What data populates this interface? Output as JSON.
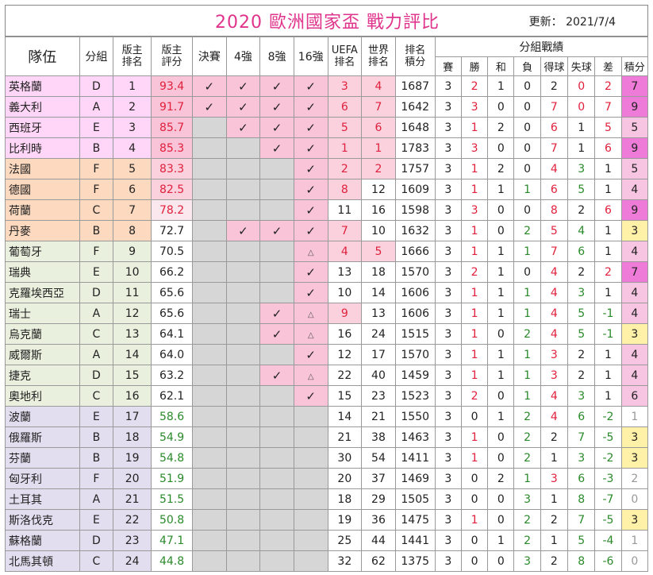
{
  "title": "2020 歐洲國家盃 戰力評比",
  "updated": "更新： 2021/7/4",
  "headers": {
    "team": "隊伍",
    "group": "分組",
    "host_rank": "版主\n排名",
    "host_score": "版主\n評分",
    "final": "決賽",
    "semi": "4強",
    "quarter": "8強",
    "r16": "16強",
    "uefa_rank": "UEFA\n排名",
    "world_rank": "世界\n排名",
    "rank_points": "排名\n積分",
    "group_record": "分組戰績",
    "played": "賽",
    "won": "勝",
    "draw": "和",
    "lost": "負",
    "gf": "得球",
    "ga": "失球",
    "gd": "差",
    "pts": "積分"
  },
  "symbols": {
    "check": "✓",
    "triangle": "△"
  },
  "colors": {
    "title": "#e0348c",
    "red": "#e0203c",
    "green": "#2a8a2a",
    "magenta": "#ef7bd8",
    "yellow": "#fff1a8"
  },
  "teams": [
    {
      "name": "英格蘭",
      "group": "D",
      "host_rank": "1",
      "host_score": "93.4",
      "final": "check",
      "semi": "check",
      "quarter": "check",
      "r16": "check",
      "uefa": "3",
      "world": "4",
      "points": "1687",
      "p": "3",
      "w": "2",
      "d": "1",
      "l": "0",
      "gf": "2",
      "ga": "0",
      "gd": "2",
      "pts": "7"
    },
    {
      "name": "義大利",
      "group": "A",
      "host_rank": "2",
      "host_score": "91.7",
      "final": "check",
      "semi": "check",
      "quarter": "check",
      "r16": "check",
      "uefa": "6",
      "world": "7",
      "points": "1642",
      "p": "3",
      "w": "3",
      "d": "0",
      "l": "0",
      "gf": "7",
      "ga": "0",
      "gd": "7",
      "pts": "9"
    },
    {
      "name": "西班牙",
      "group": "E",
      "host_rank": "3",
      "host_score": "85.7",
      "final": "",
      "semi": "check",
      "quarter": "check",
      "r16": "check",
      "uefa": "5",
      "world": "6",
      "points": "1648",
      "p": "3",
      "w": "1",
      "d": "2",
      "l": "0",
      "gf": "6",
      "ga": "1",
      "gd": "5",
      "pts": "5"
    },
    {
      "name": "比利時",
      "group": "B",
      "host_rank": "4",
      "host_score": "85.3",
      "final": "",
      "semi": "",
      "quarter": "check",
      "r16": "check",
      "uefa": "1",
      "world": "1",
      "points": "1783",
      "p": "3",
      "w": "3",
      "d": "0",
      "l": "0",
      "gf": "7",
      "ga": "1",
      "gd": "6",
      "pts": "9"
    },
    {
      "name": "法國",
      "group": "F",
      "host_rank": "5",
      "host_score": "83.3",
      "final": "",
      "semi": "",
      "quarter": "",
      "r16": "check",
      "uefa": "2",
      "world": "2",
      "points": "1757",
      "p": "3",
      "w": "1",
      "d": "2",
      "l": "0",
      "gf": "4",
      "ga": "3",
      "gd": "1",
      "pts": "5"
    },
    {
      "name": "德國",
      "group": "F",
      "host_rank": "6",
      "host_score": "82.5",
      "final": "",
      "semi": "",
      "quarter": "",
      "r16": "check",
      "uefa": "8",
      "world": "12",
      "points": "1609",
      "p": "3",
      "w": "1",
      "d": "1",
      "l": "1",
      "gf": "6",
      "ga": "5",
      "gd": "1",
      "pts": "4"
    },
    {
      "name": "荷蘭",
      "group": "C",
      "host_rank": "7",
      "host_score": "78.2",
      "final": "",
      "semi": "",
      "quarter": "",
      "r16": "check",
      "uefa": "11",
      "world": "16",
      "points": "1598",
      "p": "3",
      "w": "3",
      "d": "0",
      "l": "0",
      "gf": "8",
      "ga": "2",
      "gd": "6",
      "pts": "9"
    },
    {
      "name": "丹麥",
      "group": "B",
      "host_rank": "8",
      "host_score": "72.7",
      "final": "",
      "semi": "check",
      "quarter": "check",
      "r16": "check",
      "uefa": "7",
      "world": "10",
      "points": "1632",
      "p": "3",
      "w": "1",
      "d": "0",
      "l": "2",
      "gf": "5",
      "ga": "4",
      "gd": "1",
      "pts": "3"
    },
    {
      "name": "葡萄牙",
      "group": "F",
      "host_rank": "9",
      "host_score": "70.5",
      "final": "",
      "semi": "",
      "quarter": "",
      "r16": "tri",
      "uefa": "4",
      "world": "5",
      "points": "1666",
      "p": "3",
      "w": "1",
      "d": "1",
      "l": "1",
      "gf": "7",
      "ga": "6",
      "gd": "1",
      "pts": "4"
    },
    {
      "name": "瑞典",
      "group": "E",
      "host_rank": "10",
      "host_score": "66.2",
      "final": "",
      "semi": "",
      "quarter": "",
      "r16": "check",
      "uefa": "13",
      "world": "18",
      "points": "1570",
      "p": "3",
      "w": "2",
      "d": "1",
      "l": "0",
      "gf": "4",
      "ga": "2",
      "gd": "2",
      "pts": "7"
    },
    {
      "name": "克羅埃西亞",
      "group": "D",
      "host_rank": "11",
      "host_score": "65.6",
      "final": "",
      "semi": "",
      "quarter": "",
      "r16": "check",
      "uefa": "10",
      "world": "14",
      "points": "1606",
      "p": "3",
      "w": "1",
      "d": "1",
      "l": "1",
      "gf": "4",
      "ga": "3",
      "gd": "1",
      "pts": "4"
    },
    {
      "name": "瑞士",
      "group": "A",
      "host_rank": "12",
      "host_score": "65.6",
      "final": "",
      "semi": "",
      "quarter": "check",
      "r16": "tri",
      "uefa": "9",
      "world": "13",
      "points": "1606",
      "p": "3",
      "w": "1",
      "d": "1",
      "l": "1",
      "gf": "4",
      "ga": "5",
      "gd": "-1",
      "pts": "4"
    },
    {
      "name": "烏克蘭",
      "group": "C",
      "host_rank": "13",
      "host_score": "64.1",
      "final": "",
      "semi": "",
      "quarter": "check",
      "r16": "tri",
      "uefa": "16",
      "world": "24",
      "points": "1515",
      "p": "3",
      "w": "1",
      "d": "0",
      "l": "2",
      "gf": "4",
      "ga": "5",
      "gd": "-1",
      "pts": "3"
    },
    {
      "name": "威爾斯",
      "group": "A",
      "host_rank": "14",
      "host_score": "64.0",
      "final": "",
      "semi": "",
      "quarter": "",
      "r16": "check",
      "uefa": "12",
      "world": "17",
      "points": "1570",
      "p": "3",
      "w": "1",
      "d": "1",
      "l": "1",
      "gf": "3",
      "ga": "2",
      "gd": "1",
      "pts": "4"
    },
    {
      "name": "捷克",
      "group": "D",
      "host_rank": "15",
      "host_score": "63.2",
      "final": "",
      "semi": "",
      "quarter": "check",
      "r16": "tri",
      "uefa": "22",
      "world": "40",
      "points": "1459",
      "p": "3",
      "w": "1",
      "d": "1",
      "l": "1",
      "gf": "3",
      "ga": "2",
      "gd": "1",
      "pts": "4"
    },
    {
      "name": "奧地利",
      "group": "C",
      "host_rank": "16",
      "host_score": "62.1",
      "final": "",
      "semi": "",
      "quarter": "",
      "r16": "check",
      "uefa": "15",
      "world": "23",
      "points": "1523",
      "p": "3",
      "w": "2",
      "d": "0",
      "l": "1",
      "gf": "4",
      "ga": "3",
      "gd": "1",
      "pts": "6"
    },
    {
      "name": "波蘭",
      "group": "E",
      "host_rank": "17",
      "host_score": "58.6",
      "final": "",
      "semi": "",
      "quarter": "",
      "r16": "",
      "uefa": "14",
      "world": "21",
      "points": "1550",
      "p": "3",
      "w": "0",
      "d": "1",
      "l": "2",
      "gf": "4",
      "ga": "6",
      "gd": "-2",
      "pts": "1"
    },
    {
      "name": "俄羅斯",
      "group": "B",
      "host_rank": "18",
      "host_score": "54.9",
      "final": "",
      "semi": "",
      "quarter": "",
      "r16": "",
      "uefa": "21",
      "world": "38",
      "points": "1463",
      "p": "3",
      "w": "1",
      "d": "0",
      "l": "2",
      "gf": "2",
      "ga": "7",
      "gd": "-5",
      "pts": "3"
    },
    {
      "name": "芬蘭",
      "group": "B",
      "host_rank": "19",
      "host_score": "54.8",
      "final": "",
      "semi": "",
      "quarter": "",
      "r16": "",
      "uefa": "30",
      "world": "54",
      "points": "1411",
      "p": "3",
      "w": "1",
      "d": "0",
      "l": "2",
      "gf": "1",
      "ga": "3",
      "gd": "-2",
      "pts": "3"
    },
    {
      "name": "匈牙利",
      "group": "F",
      "host_rank": "20",
      "host_score": "51.9",
      "final": "",
      "semi": "",
      "quarter": "",
      "r16": "",
      "uefa": "20",
      "world": "37",
      "points": "1469",
      "p": "3",
      "w": "0",
      "d": "2",
      "l": "1",
      "gf": "3",
      "ga": "6",
      "gd": "-3",
      "pts": "2"
    },
    {
      "name": "土耳其",
      "group": "A",
      "host_rank": "21",
      "host_score": "51.5",
      "final": "",
      "semi": "",
      "quarter": "",
      "r16": "",
      "uefa": "18",
      "world": "29",
      "points": "1505",
      "p": "3",
      "w": "0",
      "d": "0",
      "l": "3",
      "gf": "1",
      "ga": "8",
      "gd": "-7",
      "pts": "0"
    },
    {
      "name": "斯洛伐克",
      "group": "E",
      "host_rank": "22",
      "host_score": "50.8",
      "final": "",
      "semi": "",
      "quarter": "",
      "r16": "",
      "uefa": "19",
      "world": "36",
      "points": "1475",
      "p": "3",
      "w": "1",
      "d": "0",
      "l": "2",
      "gf": "2",
      "ga": "7",
      "gd": "-5",
      "pts": "3"
    },
    {
      "name": "蘇格蘭",
      "group": "D",
      "host_rank": "23",
      "host_score": "47.1",
      "final": "",
      "semi": "",
      "quarter": "",
      "r16": "",
      "uefa": "25",
      "world": "44",
      "points": "1441",
      "p": "3",
      "w": "0",
      "d": "1",
      "l": "2",
      "gf": "1",
      "ga": "5",
      "gd": "-4",
      "pts": "1"
    },
    {
      "name": "北馬其頓",
      "group": "C",
      "host_rank": "24",
      "host_score": "44.8",
      "final": "",
      "semi": "",
      "quarter": "",
      "r16": "",
      "uefa": "32",
      "world": "62",
      "points": "1375",
      "p": "3",
      "w": "0",
      "d": "0",
      "l": "3",
      "gf": "2",
      "ga": "8",
      "gd": "-6",
      "pts": "0"
    }
  ]
}
